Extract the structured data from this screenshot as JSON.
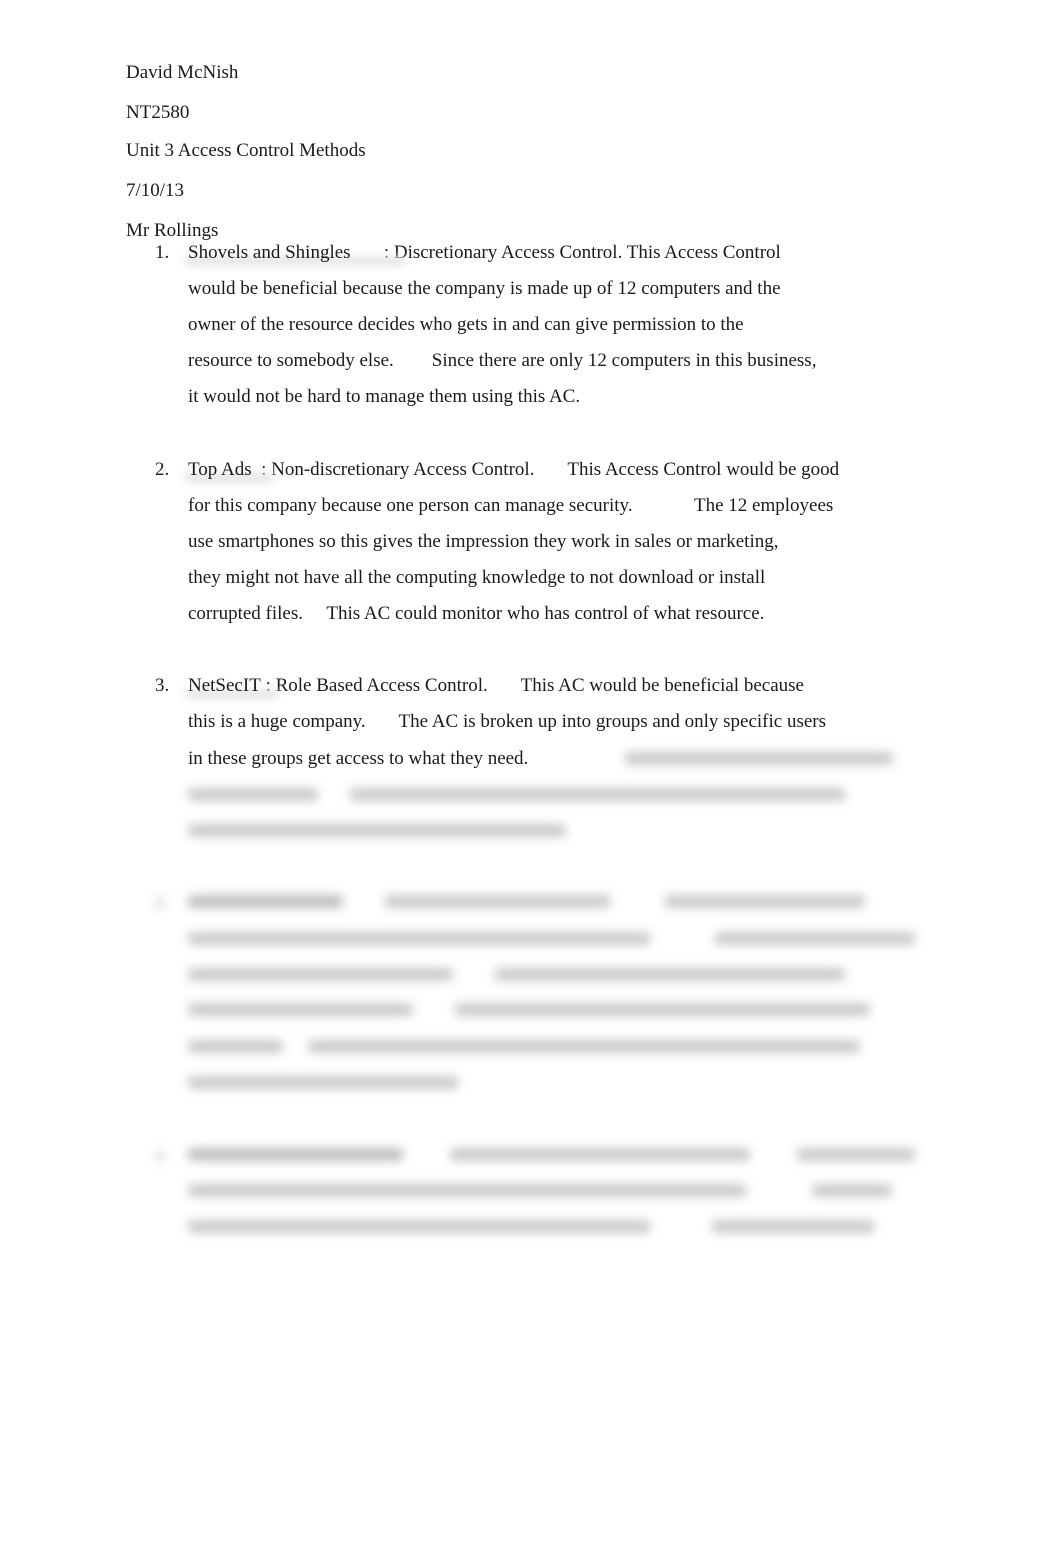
{
  "document": {
    "header": {
      "author": "David McNish",
      "course": "NT2580",
      "title": "Unit 3 Access Control Methods",
      "date": "7/10/13",
      "instructor": "Mr Rollings"
    },
    "items": [
      {
        "number": "1.",
        "company": "Shovels and Shingles",
        "lines": [
          "       : Discretionary Access Control. This Access Control",
          "would be beneficial because the company is made up of 12 computers and the",
          "owner of the resource decides who gets in and can give permission to the",
          "resource to somebody else.        Since there are only 12 computers in this business,",
          "it would not be hard to manage them using this AC."
        ]
      },
      {
        "number": "2.",
        "company": "Top Ads",
        "lines": [
          "  : Non-discretionary Access Control.       This Access Control would be good",
          "for this company because one person can manage security.             The 12 employees",
          "use smartphones so this gives the impression they work in sales or marketing,",
          "they might not have all the computing knowledge to not download or install",
          "corrupted files.     This AC could monitor who has control of what resource."
        ]
      },
      {
        "number": "3.",
        "company": "NetSecIT",
        "lines": [
          " : Role Based Access Control.       This AC would be beneficial because",
          "this is a huge company.       The AC is broken up into groups and only specific users",
          "in these groups get access to what they need."
        ]
      }
    ],
    "redacted_note": "Remaining content blurred / not legible"
  }
}
